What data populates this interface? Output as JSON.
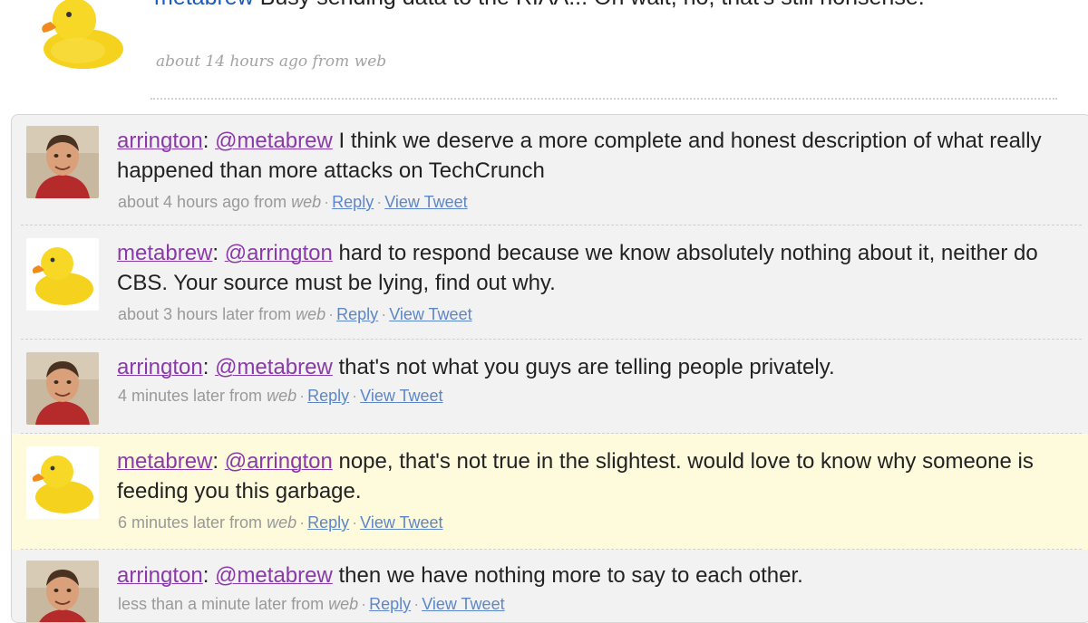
{
  "top_tweet": {
    "user": "metabrew",
    "text": "Busy sending data to the RIAA... Oh wait, no, that's still nonsense.",
    "meta": "about 14 hours ago from web",
    "avatar_icon": "rubber-duck-icon"
  },
  "conversation": [
    {
      "user": "arrington",
      "mention": "@metabrew",
      "text": "I think we deserve a more complete and honest description of what really happened than more attacks on TechCrunch",
      "time": "about 4 hours ago from",
      "source": "web",
      "reply_label": "Reply",
      "view_label": "View Tweet",
      "avatar_icon": "arrington-avatar-icon",
      "highlighted": false
    },
    {
      "user": "metabrew",
      "mention": "@arrington",
      "text": "hard to respond because we know absolutely nothing about it, neither do CBS. Your source must be lying, find out why.",
      "time": "about 3 hours later from",
      "source": "web",
      "reply_label": "Reply",
      "view_label": "View Tweet",
      "avatar_icon": "rubber-duck-icon",
      "highlighted": false
    },
    {
      "user": "arrington",
      "mention": "@metabrew",
      "text": "that's not what you guys are telling people privately.",
      "time": "4 minutes later from",
      "source": "web",
      "reply_label": "Reply",
      "view_label": "View Tweet",
      "avatar_icon": "arrington-avatar-icon",
      "highlighted": false
    },
    {
      "user": "metabrew",
      "mention": "@arrington",
      "text": "nope, that's not true in the slightest. would love to know why someone is feeding you this garbage.",
      "time": "6 minutes later from",
      "source": "web",
      "reply_label": "Reply",
      "view_label": "View Tweet",
      "avatar_icon": "rubber-duck-icon",
      "highlighted": true
    },
    {
      "user": "arrington",
      "mention": "@metabrew",
      "text": "then we have nothing more to say to each other.",
      "time": "less than a minute later from",
      "source": "web",
      "reply_label": "Reply",
      "view_label": "View Tweet",
      "avatar_icon": "arrington-avatar-icon",
      "highlighted": false
    }
  ],
  "colors": {
    "username": "#8a3aa8",
    "link": "#5d86c9",
    "highlight_bg": "#fdfbdc",
    "box_bg": "#f2f2f2"
  }
}
